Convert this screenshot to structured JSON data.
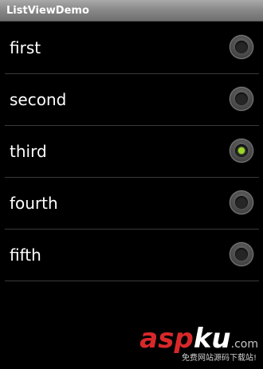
{
  "app": {
    "title": "ListViewDemo"
  },
  "list": {
    "items": [
      {
        "label": "first",
        "checked": false
      },
      {
        "label": "second",
        "checked": false
      },
      {
        "label": "third",
        "checked": true
      },
      {
        "label": "fourth",
        "checked": false
      },
      {
        "label": "fifth",
        "checked": false
      }
    ]
  },
  "watermark": {
    "brand_red": "asp",
    "brand_white": "ku",
    "domain": ".com",
    "tagline": "免费网站源码下载站!"
  },
  "colors": {
    "background": "#000000",
    "radio_checked": "#9bd52a",
    "watermark_red": "#d8282a"
  }
}
